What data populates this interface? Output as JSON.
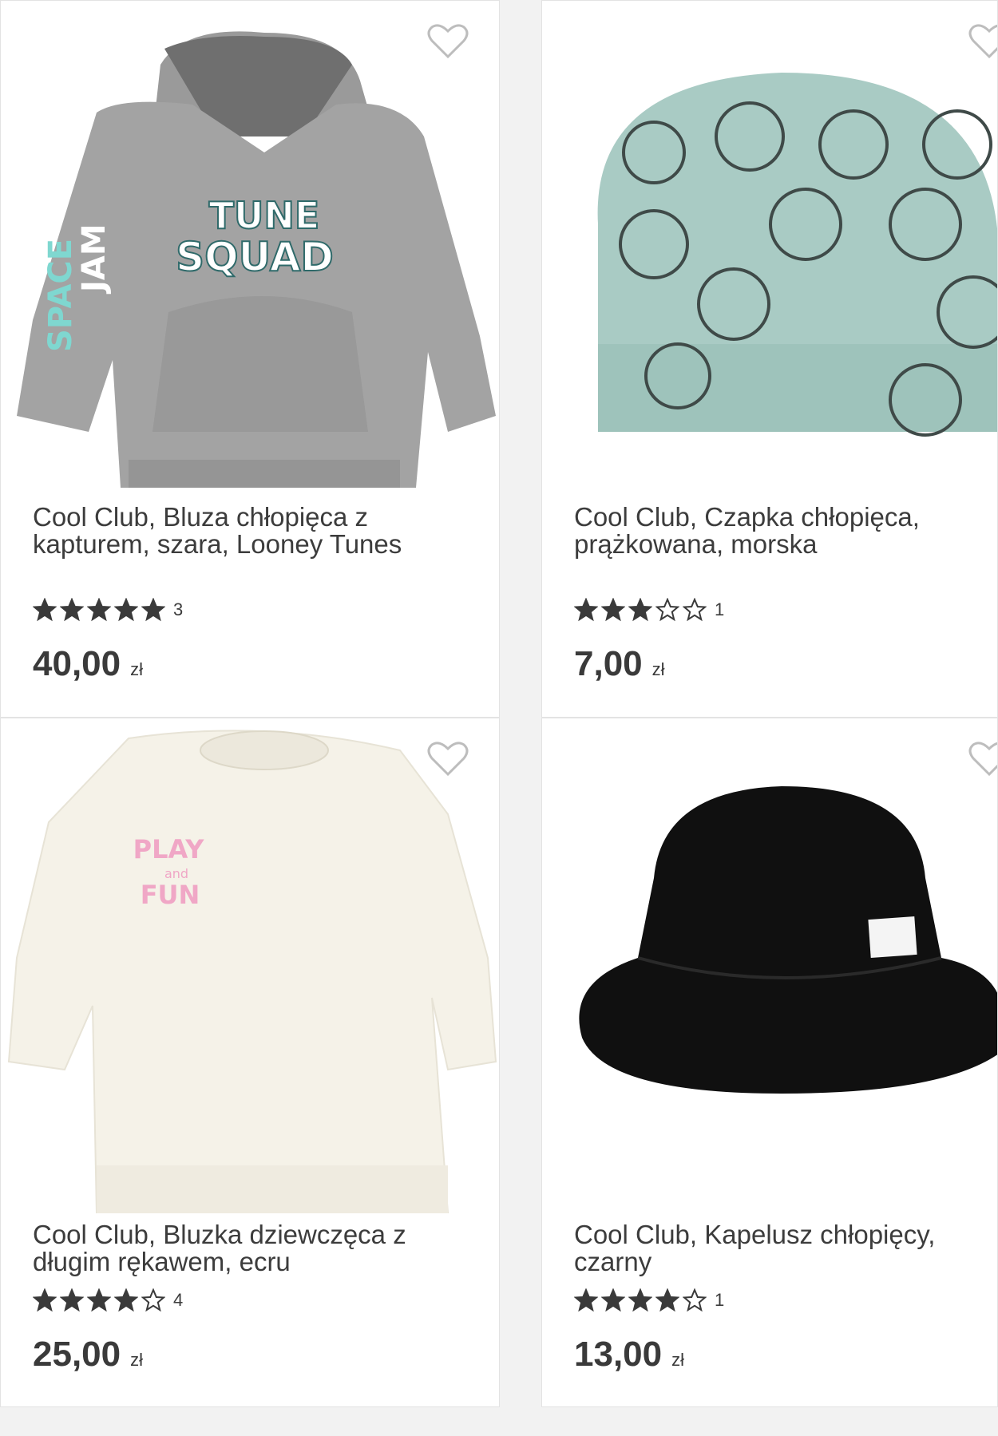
{
  "products": [
    {
      "title": "Cool Club, Bluza chłopięca z kapturem, szara, Looney Tunes",
      "rating_stars": 5,
      "rating_count": "3",
      "price": "40,00",
      "currency": "zł",
      "image": "hoodie-grey-tune-squad",
      "image_text": [
        "TUNE",
        "SQUAD",
        "SPACE",
        "JAM"
      ]
    },
    {
      "title": "Cool Club, Czapka chłopięca, prążkowana, morska",
      "rating_stars": 3,
      "rating_count": "1",
      "price": "7,00",
      "currency": "zł",
      "image": "beanie-mint-lion-print"
    },
    {
      "title": "Cool Club, Bluzka dziewczęca z długim rękawem, ecru",
      "rating_stars": 4,
      "rating_count": "4",
      "price": "25,00",
      "currency": "zł",
      "image": "sweatshirt-ecru-play-fun",
      "image_text": [
        "PLAY",
        "and",
        "FUN"
      ]
    },
    {
      "title": "Cool Club, Kapelusz chłopięcy, czarny",
      "rating_stars": 4,
      "rating_count": "1",
      "price": "13,00",
      "currency": "zł",
      "image": "bucket-hat-black"
    }
  ],
  "colors": {
    "star_filled": "#3a3a3a",
    "heart_outline": "#bdbdbd",
    "text": "#3c3c3c"
  }
}
